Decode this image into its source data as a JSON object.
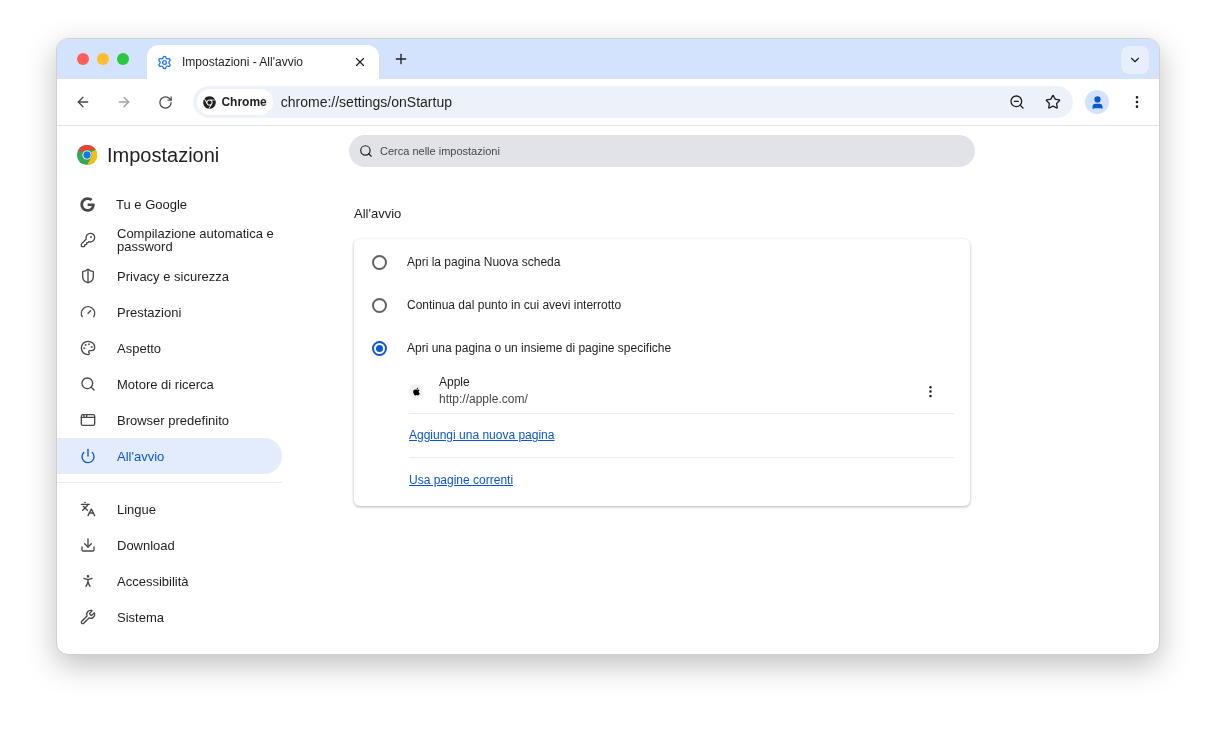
{
  "tab": {
    "title": "Impostazioni - All'avvio"
  },
  "toolbar": {
    "site_chip": "Chrome",
    "url": "chrome://settings/onStartup"
  },
  "sidebar": {
    "title": "Impostazioni",
    "groups": [
      [
        {
          "label": "Tu e Google",
          "kind": "google",
          "selected": false
        },
        {
          "label": "Compilazione automatica e password",
          "kind": "key",
          "selected": false
        },
        {
          "label": "Privacy e sicurezza",
          "kind": "shield",
          "selected": false
        },
        {
          "label": "Prestazioni",
          "kind": "gauge",
          "selected": false
        },
        {
          "label": "Aspetto",
          "kind": "palette",
          "selected": false
        },
        {
          "label": "Motore di ricerca",
          "kind": "search",
          "selected": false
        },
        {
          "label": "Browser predefinito",
          "kind": "window",
          "selected": false
        },
        {
          "label": "All'avvio",
          "kind": "power",
          "selected": true
        }
      ],
      [
        {
          "label": "Lingue",
          "kind": "languages",
          "selected": false
        },
        {
          "label": "Download",
          "kind": "download",
          "selected": false
        },
        {
          "label": "Accessibilità",
          "kind": "accessibility",
          "selected": false
        },
        {
          "label": "Sistema",
          "kind": "wrench",
          "selected": false
        }
      ]
    ]
  },
  "search": {
    "placeholder": "Cerca nelle impostazioni"
  },
  "section": {
    "title": "All'avvio",
    "options": [
      {
        "label": "Apri la pagina Nuova scheda",
        "selected": false
      },
      {
        "label": "Continua dal punto in cui avevi interrotto",
        "selected": false
      },
      {
        "label": "Apri una pagina o un insieme di pagine specifiche",
        "selected": true
      }
    ],
    "pages": [
      {
        "name": "Apple",
        "url": "http://apple.com/"
      }
    ],
    "links": [
      "Aggiungi una nuova pagina",
      "Usa pagine correnti"
    ]
  }
}
